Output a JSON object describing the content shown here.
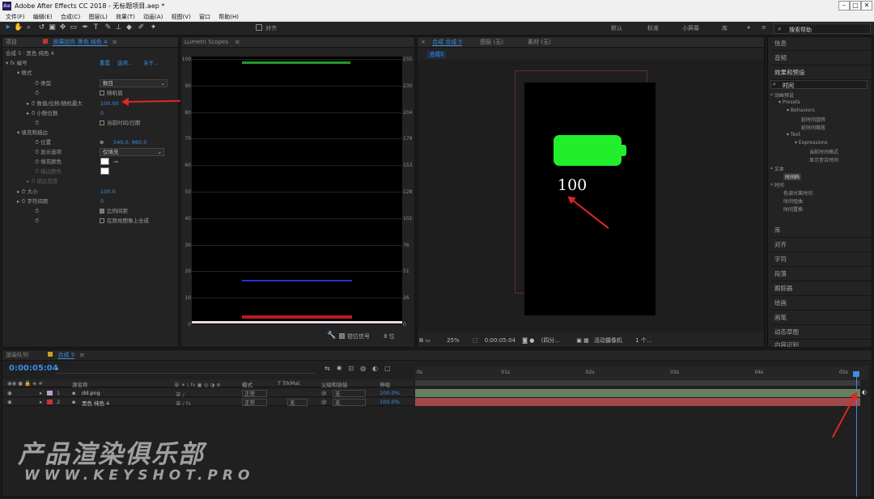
{
  "window": {
    "title": "Adobe After Effects CC 2018 - 无标题项目.aep *",
    "app_icon": "Ae"
  },
  "menu": [
    "文件(F)",
    "编辑(E)",
    "合成(C)",
    "图层(L)",
    "效果(T)",
    "动画(A)",
    "视图(V)",
    "窗口",
    "帮助(H)"
  ],
  "toolbar": {
    "snap_label": "对齐",
    "workspaces": [
      "默认",
      "标准",
      "小屏幕",
      "库"
    ],
    "search_placeholder": "搜索帮助"
  },
  "effects_panel": {
    "tabs": [
      "项目",
      "效果控件 黑色 纯色 4"
    ],
    "comp_path": "合成 5 · 黑色 纯色 4",
    "effect_name": "编号",
    "effect_links": [
      "重置",
      "选项...",
      "关于..."
    ],
    "rows": [
      {
        "label": "格式",
        "value": ""
      },
      {
        "label": "类型",
        "value": "数目"
      },
      {
        "label": "",
        "value": "随机值"
      },
      {
        "label": "数值/位移/随机最大",
        "value": "100.00"
      },
      {
        "label": "小数位数",
        "value": "0"
      },
      {
        "label": "",
        "value": "当前时间/日期"
      },
      {
        "label": "填充和描边",
        "value": ""
      },
      {
        "label": "位置",
        "value": "540.0, 960.0"
      },
      {
        "label": "显示选项",
        "value": "仅填充"
      },
      {
        "label": "填充颜色",
        "value": ""
      },
      {
        "label": "描边颜色",
        "value": ""
      },
      {
        "label": "描边宽度",
        "value": ""
      },
      {
        "label": "大小",
        "value": "100.0"
      },
      {
        "label": "字符间距",
        "value": "0"
      },
      {
        "label": "",
        "value": "比例间距"
      },
      {
        "label": "",
        "value": "在原始图像上合成"
      }
    ]
  },
  "scopes_panel": {
    "title": "Lumetri Scopes",
    "left_axis": [
      "100",
      "90",
      "80",
      "70",
      "60",
      "50",
      "40",
      "30",
      "20",
      "10",
      "0"
    ],
    "right_axis": [
      "255",
      "230",
      "204",
      "179",
      "153",
      "128",
      "102",
      "76",
      "51",
      "26",
      "0"
    ],
    "footer_label": "钳位信号",
    "footer_bits": "8 位"
  },
  "viewer_panel": {
    "tabs": [
      "合成 合成 5",
      "图层 (无)",
      "素材 (无)"
    ],
    "comp_chip": "合成5",
    "number_text": "100",
    "zoom": "25%",
    "timecode": "0:00:05:04",
    "quality": "(四分...",
    "camera": "活动摄像机",
    "views": "1 个...",
    "battery_color": "#23ee2c"
  },
  "right_panel": {
    "items_top": [
      "信息",
      "音频",
      "效果和预设"
    ],
    "search_value": "时间",
    "tree": [
      "* 动画预设",
      "Presets",
      "Behaviors",
      "延时间旋转",
      "延时间缩放",
      "Text",
      "Expressions",
      "当前时间格式",
      "显示音合时间",
      "* 文本",
      "时间码",
      "* 时间",
      "色调分离时间",
      "时间扭曲",
      "时间置换"
    ],
    "items_bottom": [
      "库",
      "对齐",
      "字符",
      "段落",
      "跟踪器",
      "绘画",
      "画笔",
      "动态草图",
      "内容识别"
    ]
  },
  "timeline": {
    "tabs": [
      "渲染队列",
      "合成 5"
    ],
    "timecode": "0:00:05:04",
    "columns": [
      "源名称",
      "模式",
      "T TrkMat",
      "父级和链接",
      "伸缩"
    ],
    "ticks": [
      "0s",
      "01s",
      "02s",
      "03s",
      "04s",
      "05s"
    ],
    "layers": [
      {
        "num": "1",
        "name": "dd.png",
        "mode": "正常",
        "trkmat": "",
        "parent": "无",
        "stretch": "100.0%",
        "color": "#b3a3cc"
      },
      {
        "num": "2",
        "name": "黑色 纯色 4",
        "mode": "正常",
        "trkmat": "无",
        "parent": "无",
        "stretch": "100.0%",
        "color": "#c63434"
      }
    ]
  },
  "watermark": {
    "line1": "产品渲染俱乐部",
    "line2": "WWW.KEYSHOT.PRO"
  }
}
